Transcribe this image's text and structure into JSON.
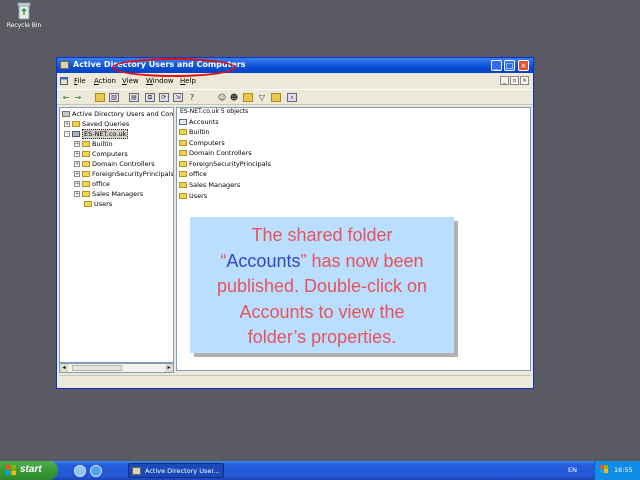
{
  "desktop": {
    "recycle_bin_label": "Recycle Bin"
  },
  "window": {
    "title": "Active Directory Users and Computers",
    "menu": [
      "File",
      "Action",
      "View",
      "Window",
      "Help"
    ],
    "tree": {
      "header": "Active Directory Users and Comp",
      "items": [
        {
          "label": "Saved Queries",
          "expander": "+"
        },
        {
          "label": "ES-NET.co.uk",
          "expander": "-",
          "selected": true
        },
        {
          "label": "Builtin",
          "expander": "+"
        },
        {
          "label": "Computers",
          "expander": "+"
        },
        {
          "label": "Domain Controllers",
          "expander": "+"
        },
        {
          "label": "ForeignSecurityPrincipals",
          "expander": "+"
        },
        {
          "label": "office",
          "expander": "+"
        },
        {
          "label": "Sales Managers",
          "expander": "+"
        },
        {
          "label": "Users",
          "expander": ""
        }
      ]
    },
    "list": {
      "header": "ES-NET.co.uk   5 objects",
      "items": [
        {
          "label": "Accounts",
          "icon": "shared-folder-icon"
        },
        {
          "label": "Builtin",
          "icon": "folder-icon"
        },
        {
          "label": "Computers",
          "icon": "folder-icon"
        },
        {
          "label": "Domain Controllers",
          "icon": "ou-folder-icon"
        },
        {
          "label": "ForeignSecurityPrincipals",
          "icon": "folder-icon"
        },
        {
          "label": "office",
          "icon": "ou-folder-icon"
        },
        {
          "label": "Sales Managers",
          "icon": "ou-folder-icon"
        },
        {
          "label": "Users",
          "icon": "folder-icon"
        }
      ]
    }
  },
  "callout": {
    "line1": "The shared folder",
    "open_quote": "“",
    "highlight": "Accounts",
    "line2_rest": "” has now been",
    "line3": "published. Double-click on",
    "line4": "Accounts to view the",
    "line5": "folder’s properties."
  },
  "taskbar": {
    "start_label": "start",
    "task_label": "Active Directory User...",
    "language": "EN",
    "clock": "16:55"
  },
  "colors": {
    "desktop": "#5a5a63",
    "callout_bg": "#b9deff",
    "callout_text": "#e8535a",
    "callout_highlight": "#3146c8",
    "highlight_oval": "#e01010"
  }
}
